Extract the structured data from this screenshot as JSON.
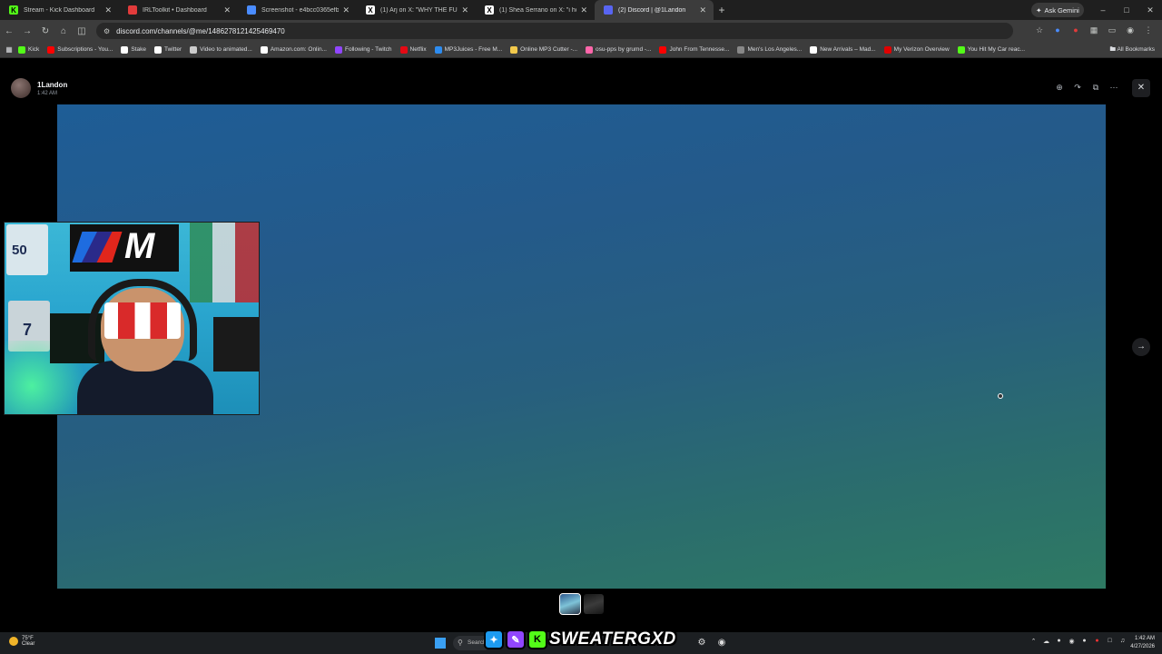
{
  "browser": {
    "tabs": [
      {
        "title": "Stream - Kick Dashboard",
        "icon": "kick-icon",
        "color": "#53fc18",
        "glyph": "K",
        "active": false
      },
      {
        "title": "IRLToolkit • Dashboard",
        "icon": "irltoolkit-icon",
        "color": "#e23b3b",
        "glyph": "",
        "active": false
      },
      {
        "title": "Screenshot - e4bcc0365efb43",
        "icon": "screenshot-icon",
        "color": "#4a8cff",
        "glyph": "",
        "active": false
      },
      {
        "title": "(1) Arj on X: \"WHY THE FUCK",
        "icon": "x-icon",
        "color": "#ffffff",
        "glyph": "X",
        "active": false
      },
      {
        "title": "(1) Shea Serrano on X: \"i hope",
        "icon": "x-icon",
        "color": "#ffffff",
        "glyph": "X",
        "active": false
      },
      {
        "title": "(2) Discord | @1Landon",
        "icon": "discord-icon",
        "color": "#5865f2",
        "glyph": "",
        "active": true
      }
    ],
    "new_tab_label": "+",
    "gemini_label": "Ask Gemini",
    "url": "discord.com/channels/@me/1486278121425469470",
    "bookmarks": [
      {
        "label": "Kick",
        "color": "#53fc18"
      },
      {
        "label": "Subscriptions - You...",
        "color": "#ff0000"
      },
      {
        "label": "Stake",
        "color": "#ffffff"
      },
      {
        "label": "Twitter",
        "color": "#ffffff"
      },
      {
        "label": "Video to animated...",
        "color": "#cccccc"
      },
      {
        "label": "Amazon.com: Onlin...",
        "color": "#ffffff"
      },
      {
        "label": "Following - Twitch",
        "color": "#9146ff"
      },
      {
        "label": "Netflix",
        "color": "#e50914"
      },
      {
        "label": "MP3Juices - Free M...",
        "color": "#2d8cf0"
      },
      {
        "label": "Online MP3 Cutter -...",
        "color": "#f2c94c"
      },
      {
        "label": "osu-pps by grumd -...",
        "color": "#ff66aa"
      },
      {
        "label": "John From Tennesse...",
        "color": "#ff0000"
      },
      {
        "label": "Men's Los Angeles...",
        "color": "#888888"
      },
      {
        "label": "New Arrivals – Mad...",
        "color": "#ffffff"
      },
      {
        "label": "My Verizon Overview",
        "color": "#e00000"
      },
      {
        "label": "You Hit My Car reac...",
        "color": "#53fc18"
      }
    ],
    "all_bookmarks_label": "All Bookmarks"
  },
  "discord": {
    "author_name": "1Landon",
    "timestamp": "1:42 AM"
  },
  "overlay": {
    "brand_text": "SWEATERGXD",
    "jersey1_number": "50",
    "jersey2_number": "7"
  },
  "taskbar": {
    "weather_temp": "75°F",
    "weather_desc": "Clear",
    "search_label": "Search",
    "time": "1:42 AM",
    "date": "4/27/2026"
  }
}
